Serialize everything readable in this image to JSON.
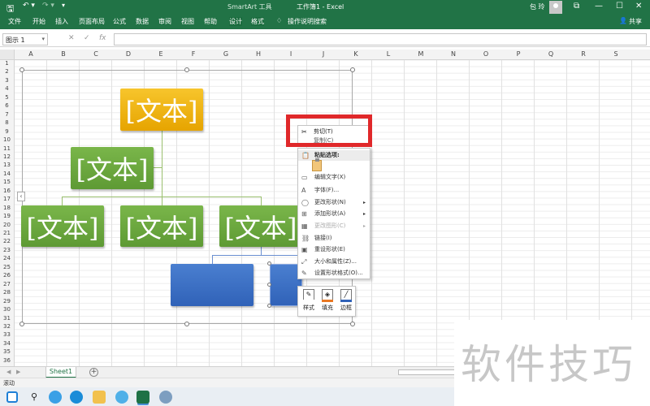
{
  "titlebar": {
    "save": "🖫",
    "undo": "↶ ▾",
    "redo": "↷ ▾",
    "customize": "▾",
    "context": "SmartArt 工具",
    "doc_title": "工作簿1  -  Excel",
    "user": "包 玲",
    "window_buttons": [
      "⧉",
      "—",
      "☐",
      "✕"
    ]
  },
  "tabs": [
    "文件",
    "开始",
    "插入",
    "页面布局",
    "公式",
    "数据",
    "审阅",
    "视图",
    "帮助",
    "设计",
    "格式"
  ],
  "tell_me": "操作说明搜索",
  "share": "共享",
  "namebox": "图示 1",
  "formula_icons": [
    "✕",
    "✓",
    "fx"
  ],
  "columns": [
    "A",
    "B",
    "C",
    "D",
    "E",
    "F",
    "G",
    "H",
    "I",
    "J",
    "K",
    "L",
    "M",
    "N",
    "O",
    "P",
    "Q",
    "R",
    "S"
  ],
  "rows": [
    "1",
    "2",
    "3",
    "4",
    "5",
    "6",
    "7",
    "8",
    "9",
    "10",
    "11",
    "12",
    "13",
    "14",
    "15",
    "16",
    "17",
    "18",
    "19",
    "20",
    "21",
    "22",
    "23",
    "24",
    "25",
    "26",
    "27",
    "28",
    "29",
    "30",
    "31",
    "32",
    "33",
    "34",
    "35",
    "36"
  ],
  "smartart": {
    "node_text": "[文本]",
    "collapse": "‹"
  },
  "context_menu": {
    "cut": "剪切(T)",
    "copy": "复制(C)",
    "paste_options": "粘贴选项:",
    "items": [
      {
        "label": "编辑文字(X)",
        "icon": "▭",
        "disabled": false,
        "submenu": false
      },
      {
        "label": "字体(F)...",
        "icon": "A",
        "disabled": false,
        "submenu": false
      },
      {
        "label": "更改形状(N)",
        "icon": "◯",
        "disabled": false,
        "submenu": true
      },
      {
        "label": "添加形状(A)",
        "icon": "⊞",
        "disabled": false,
        "submenu": true
      },
      {
        "label": "更改图形(C)",
        "icon": "▦",
        "disabled": true,
        "submenu": true
      },
      {
        "label": "链接(I)",
        "icon": "⛓",
        "disabled": false,
        "submenu": false
      },
      {
        "label": "重设形状(E)",
        "icon": "▣",
        "disabled": false,
        "submenu": false
      },
      {
        "label": "大小和属性(Z)...",
        "icon": "⤢",
        "disabled": false,
        "submenu": false
      },
      {
        "label": "设置形状格式(O)...",
        "icon": "✎",
        "disabled": false,
        "submenu": false
      }
    ]
  },
  "mini_toolbar": [
    {
      "label": "样式",
      "icon": "✎",
      "color": "#ffffff"
    },
    {
      "label": "填充",
      "icon": "◈",
      "color": "#e87722"
    },
    {
      "label": "边框",
      "icon": "╱",
      "color": "#3062b8"
    }
  ],
  "sheet_tab": "Sheet1",
  "add_sheet": "+",
  "status": "滚动",
  "watermark": "软件技巧",
  "colors": {
    "excel_green": "#217346",
    "red_highlight": "#e0282a",
    "node_gold": "#f4b710",
    "node_green": "#6aa83e",
    "node_blue": "#3a6fc4"
  }
}
